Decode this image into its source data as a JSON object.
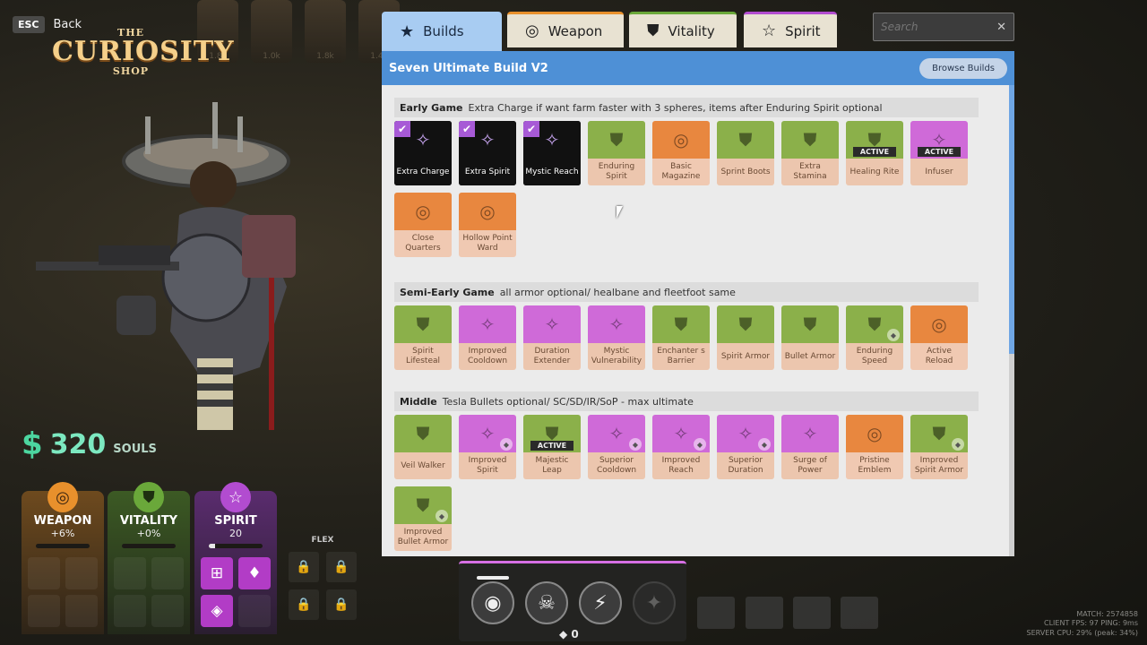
{
  "esc": {
    "key": "ESC",
    "label": "Back"
  },
  "shop": {
    "line1": "THE",
    "line2": "CURIOSITY",
    "line3": "SHOP"
  },
  "top_heroes": [
    "1.8k",
    "1.0k",
    "1.8k",
    "1.4k"
  ],
  "souls": {
    "amount": "320",
    "label": "SOULS",
    "color": "#4cd6a0"
  },
  "stats": {
    "weapon": {
      "name": "WEAPON",
      "value": "+6%",
      "fill": 0,
      "color": "#e8902c"
    },
    "vitality": {
      "name": "VITALITY",
      "value": "+0%",
      "fill": 0,
      "color": "#6aa83a"
    },
    "spirit": {
      "name": "SPIRIT",
      "value": "20",
      "fill": 0.12,
      "color": "#b24cd0"
    }
  },
  "flex": {
    "label": "FLEX"
  },
  "tabs": [
    {
      "label": "Builds",
      "icon": "star-icon"
    },
    {
      "label": "Weapon",
      "icon": "weapon-icon"
    },
    {
      "label": "Vitality",
      "icon": "vitality-icon"
    },
    {
      "label": "Spirit",
      "icon": "spirit-icon"
    }
  ],
  "search": {
    "placeholder": "Search"
  },
  "build": {
    "title": "Seven Ultimate Build V2",
    "browse_label": "Browse Builds"
  },
  "sections": [
    {
      "name": "Early Game",
      "note": "Extra Charge if want farm faster with 3 spheres, items after Enduring Spirit optional",
      "items": [
        {
          "name": "Extra Charge",
          "type": "spirit",
          "owned": true
        },
        {
          "name": "Extra Spirit",
          "type": "spirit",
          "owned": true
        },
        {
          "name": "Mystic Reach",
          "type": "spirit",
          "owned": true
        },
        {
          "name": "Enduring Spirit",
          "type": "vitality"
        },
        {
          "name": "Basic Magazine",
          "type": "weapon"
        },
        {
          "name": "Sprint Boots",
          "type": "vitality"
        },
        {
          "name": "Extra Stamina",
          "type": "vitality"
        },
        {
          "name": "Healing Rite",
          "type": "vitality",
          "active": true
        },
        {
          "name": "Infuser",
          "type": "spirit",
          "active": true
        },
        {
          "name": "Close Quarters",
          "type": "weapon"
        },
        {
          "name": "Hollow Point Ward",
          "type": "weapon"
        }
      ]
    },
    {
      "name": "Semi-Early Game",
      "note": "all armor optional/ healbane and fleetfoot same",
      "items": [
        {
          "name": "Spirit Lifesteal",
          "type": "vitality"
        },
        {
          "name": "Improved Cooldown",
          "type": "spirit"
        },
        {
          "name": "Duration Extender",
          "type": "spirit"
        },
        {
          "name": "Mystic Vulnerability",
          "type": "spirit"
        },
        {
          "name": "Enchanter s Barrier",
          "type": "vitality"
        },
        {
          "name": "Spirit Armor",
          "type": "vitality"
        },
        {
          "name": "Bullet Armor",
          "type": "vitality"
        },
        {
          "name": "Enduring Speed",
          "type": "vitality",
          "badge": true
        },
        {
          "name": "Active Reload",
          "type": "weapon"
        }
      ]
    },
    {
      "name": "Middle",
      "note": "Tesla Bullets optional/ SC/SD/IR/SoP - max ultimate",
      "items": [
        {
          "name": "Veil Walker",
          "type": "vitality"
        },
        {
          "name": "Improved Spirit",
          "type": "spirit",
          "badge": true
        },
        {
          "name": "Majestic Leap",
          "type": "vitality",
          "active": true
        },
        {
          "name": "Superior Cooldown",
          "type": "spirit",
          "badge": true
        },
        {
          "name": "Improved Reach",
          "type": "spirit",
          "badge": true
        },
        {
          "name": "Superior Duration",
          "type": "spirit",
          "badge": true
        },
        {
          "name": "Surge of Power",
          "type": "spirit"
        },
        {
          "name": "Pristine Emblem",
          "type": "weapon"
        },
        {
          "name": "Improved Spirit Armor",
          "type": "vitality",
          "badge": true
        },
        {
          "name": "Improved Bullet Armor",
          "type": "vitality",
          "badge": true
        }
      ]
    }
  ],
  "active_label": "ACTIVE",
  "ability": {
    "count": "0"
  },
  "corner_stats": [
    "MATCH: 2574858",
    "CLIENT FPS: 97   PING: 9ms",
    "SERVER CPU: 29% (peak: 34%)"
  ]
}
